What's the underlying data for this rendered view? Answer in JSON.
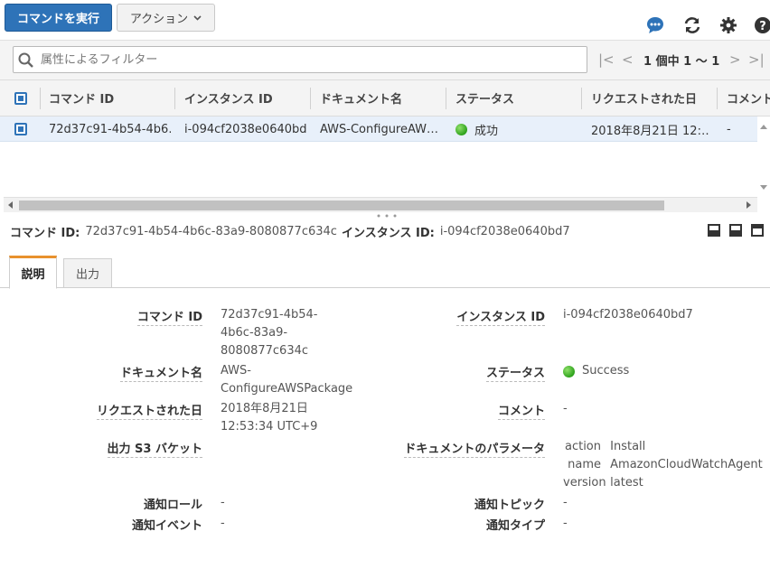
{
  "toolbar": {
    "run_command_label": "コマンドを実行",
    "actions_label": "アクション"
  },
  "filter": {
    "placeholder": "属性によるフィルター",
    "pager_text": "1 個中 1 ～ 1"
  },
  "table": {
    "headers": [
      "コマンド ID",
      "インスタンス ID",
      "ドキュメント名",
      "ステータス",
      "リクエストされた日",
      "コメント"
    ],
    "rows": [
      {
        "command_id": "72d37c91-4b54-4b6…",
        "instance_id": "i-094cf2038e0640bd7",
        "document": "AWS-ConfigureAW…",
        "status": "成功",
        "requested": "2018年8月21日 12:…",
        "comment": "-"
      }
    ]
  },
  "detail": {
    "command_id_label": "コマンド ID:",
    "command_id_value": "72d37c91-4b54-4b6c-83a9-8080877c634c",
    "instance_id_label": "インスタンス ID:",
    "instance_id_value": "i-094cf2038e0640bd7",
    "tabs": [
      "説明",
      "出力"
    ],
    "fields": {
      "command_id": {
        "label": "コマンド ID",
        "lines": [
          "72d37c91-4b54-",
          "4b6c-83a9-",
          "8080877c634c"
        ]
      },
      "instance_id": {
        "label": "インスタンス ID",
        "value": "i-094cf2038e0640bd7"
      },
      "document": {
        "label": "ドキュメント名",
        "lines": [
          "AWS-",
          "ConfigureAWSPackage"
        ]
      },
      "status": {
        "label": "ステータス",
        "value": "Success"
      },
      "requested": {
        "label": "リクエストされた日",
        "lines": [
          "2018年8月21日",
          "12:53:34 UTC+9"
        ]
      },
      "comment": {
        "label": "コメント",
        "value": "-"
      },
      "s3_bucket": {
        "label": "出力 S3 バケット"
      },
      "doc_params": {
        "label": "ドキュメントのパラメータ",
        "params": [
          {
            "key": "action",
            "value": "Install"
          },
          {
            "key": "name",
            "value": "AmazonCloudWatchAgent"
          },
          {
            "key": "version",
            "value": "latest"
          }
        ]
      },
      "notify_role": {
        "label": "通知ロール",
        "value": "-"
      },
      "notify_topic": {
        "label": "通知トピック",
        "value": "-"
      },
      "notify_event": {
        "label": "通知イベント",
        "value": "-"
      },
      "notify_type": {
        "label": "通知タイプ",
        "value": "-"
      }
    }
  },
  "colors": {
    "primary": "#2e73b8",
    "selected_row": "#e8f0fa",
    "success": "#2ea21c",
    "active_tab": "#e8912d"
  },
  "icons": [
    "chat-icon",
    "refresh-icon",
    "gear-icon",
    "help-icon",
    "search-icon",
    "first-page-icon",
    "prev-page-icon",
    "next-page-icon",
    "last-page-icon"
  ]
}
